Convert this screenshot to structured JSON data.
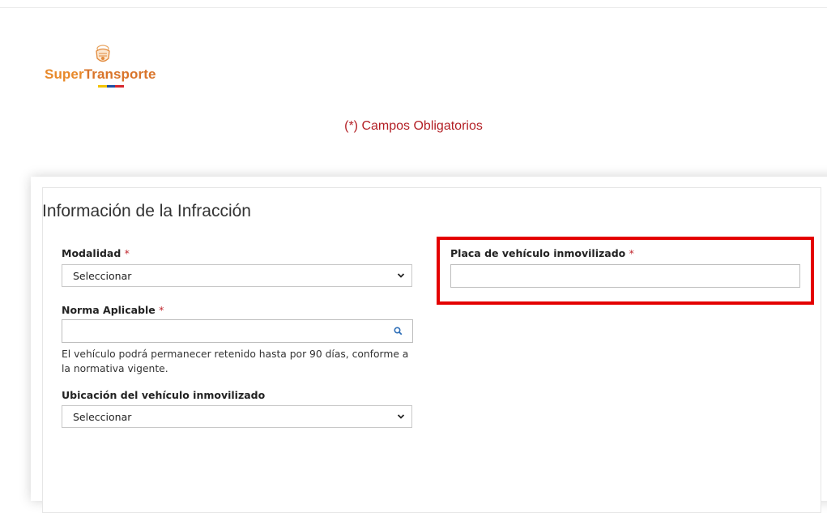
{
  "brand": {
    "logo_text_super": "Super",
    "logo_text_transporte": "Transporte",
    "primary_color": "#e8892a",
    "flag_colors": [
      "#f2c200",
      "#1f4fa3",
      "#d7262e"
    ]
  },
  "required_note": "(*) Campos Obligatorios",
  "accent_red": "#b31f25",
  "section": {
    "title": "Información de la Infracción"
  },
  "form": {
    "modalidad": {
      "label": "Modalidad",
      "required_mark": "*",
      "selected": "Seleccionar"
    },
    "norma_aplicable": {
      "label": "Norma Aplicable",
      "required_mark": "*",
      "value": "",
      "help_text": "El vehículo podrá permanecer retenido hasta por 90 días, conforme a la normativa vigente."
    },
    "ubicacion": {
      "label": "Ubicación del vehículo inmovilizado",
      "selected": "Seleccionar"
    },
    "placa": {
      "label": "Placa de vehículo inmovilizado",
      "required_mark": "*",
      "value": ""
    }
  },
  "icons": {
    "search": "search-icon",
    "dropdown": "chevron-down-icon",
    "emblem": "coat-of-arms-icon"
  }
}
